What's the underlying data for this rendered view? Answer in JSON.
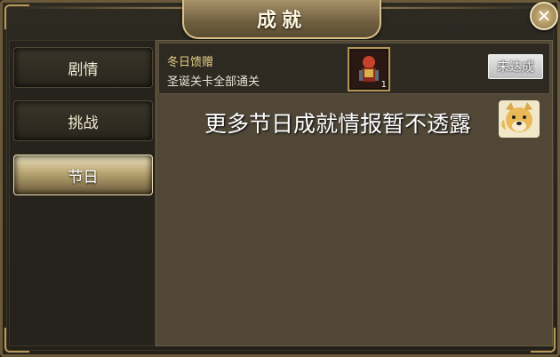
{
  "title": "成就",
  "close_icon": "close-icon",
  "tabs": [
    {
      "label": "剧情"
    },
    {
      "label": "挑战"
    },
    {
      "label": "节日"
    }
  ],
  "active_tab": 2,
  "achievement": {
    "name": "冬日馈赠",
    "description": "圣诞关卡全部通关",
    "reward_count": "1",
    "status": "未达成"
  },
  "notice": "更多节日成就情报暂不透露",
  "colors": {
    "accent": "#e4cf86",
    "panel": "#504737",
    "frame": "#b89a5a"
  }
}
